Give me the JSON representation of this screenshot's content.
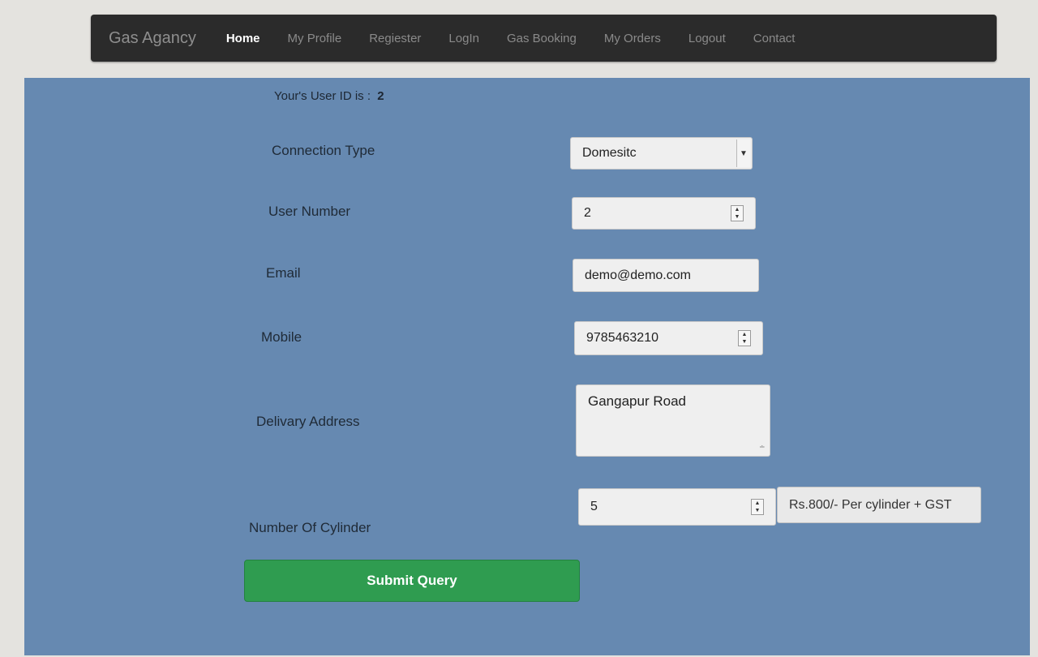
{
  "nav": {
    "brand": "Gas Agancy",
    "items": [
      {
        "label": "Home",
        "active": true
      },
      {
        "label": "My Profile",
        "active": false
      },
      {
        "label": "Regiester",
        "active": false
      },
      {
        "label": "LogIn",
        "active": false
      },
      {
        "label": "Gas Booking",
        "active": false
      },
      {
        "label": "My Orders",
        "active": false
      },
      {
        "label": "Logout",
        "active": false
      },
      {
        "label": "Contact",
        "active": false
      }
    ]
  },
  "form": {
    "user_id_text": "Your's User ID is :",
    "user_id_value": "2",
    "connection_type": {
      "label": "Connection Type",
      "value": "Domesitc"
    },
    "user_number": {
      "label": "User Number",
      "value": "2"
    },
    "email": {
      "label": "Email",
      "value": "demo@demo.com"
    },
    "mobile": {
      "label": "Mobile",
      "value": "9785463210"
    },
    "delivery_address": {
      "label": "Delivary Address",
      "value": "Gangapur Road"
    },
    "cylinders": {
      "label": "Number Of Cylinder",
      "value": "5",
      "price_note": "Rs.800/- Per cylinder + GST"
    },
    "submit_label": "Submit Query"
  },
  "colors": {
    "navbar": "#2b2b2b",
    "panel": "#6689b1",
    "submit": "#2f9c50"
  }
}
